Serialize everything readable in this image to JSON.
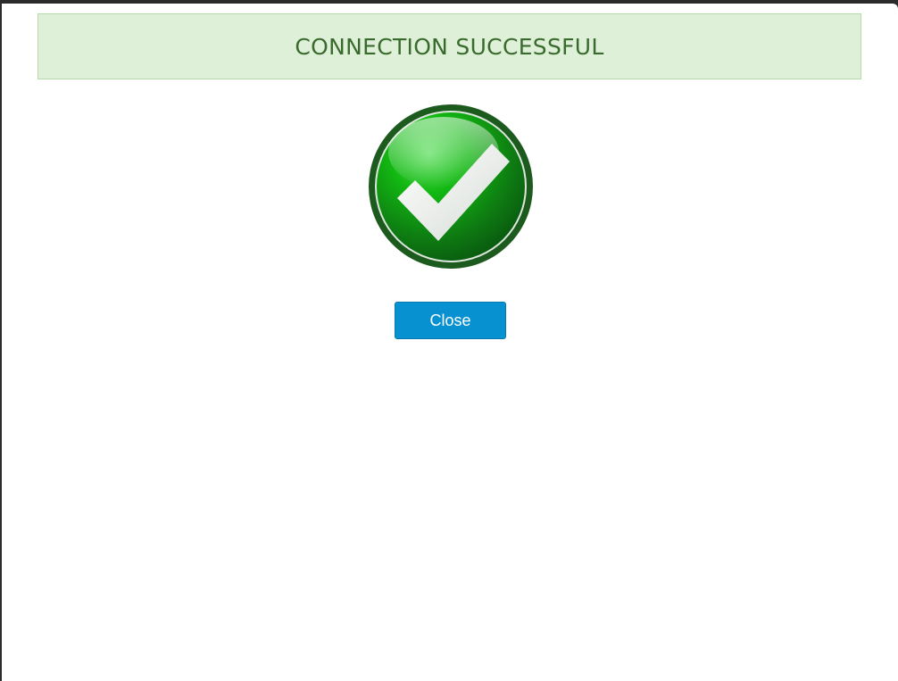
{
  "dialog": {
    "title": "CONNECTION SUCCESSFUL",
    "status_icon": "checkmark-circle-icon",
    "close_label": "Close"
  },
  "colors": {
    "banner_bg": "#dff0d8",
    "banner_text": "#3a6b2e",
    "button_bg": "#0891d1",
    "success_green": "#1e8f1e"
  }
}
